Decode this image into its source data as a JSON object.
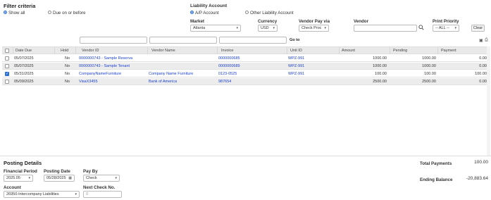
{
  "filter": {
    "title": "Filter criteria",
    "show_all": "Show all",
    "due_on_or_before": "Due on or before"
  },
  "liability": {
    "title": "Liability Account",
    "ap_account": "A/P Account",
    "other": "Other Liability Account"
  },
  "market": {
    "label": "Market",
    "value": "Atlanta"
  },
  "currency": {
    "label": "Currency",
    "value": "USD"
  },
  "vendor_pay_via": {
    "label": "Vendor Pay via",
    "value": "Check Proc"
  },
  "vendor": {
    "label": "Vendor",
    "value": ""
  },
  "print_priority": {
    "label": "Print Priority",
    "value": "-- ALL --"
  },
  "clear_label": "Clear",
  "goto_label": "Go to",
  "grid": {
    "headers": [
      "Date Due",
      "Hold",
      "Vendor ID",
      "Vendor Name",
      "Invoice",
      "Unit ID",
      "Amount",
      "Pending",
      "Payment"
    ],
    "rows": [
      {
        "checked": false,
        "date_due": "05/07/2025",
        "hold": "No",
        "vendor_id": "0000000743 - Sample Reserva",
        "vendor_name": "",
        "invoice": "0000000685",
        "unit_id": "WPZ-991",
        "amount": "1000.00",
        "pending": "1000.00",
        "payment": "0.00"
      },
      {
        "checked": false,
        "date_due": "05/07/2025",
        "hold": "No",
        "vendor_id": "0000000743 - Sample Tenant",
        "vendor_name": "",
        "invoice": "0000000689",
        "unit_id": "WPZ-991",
        "amount": "1000.00",
        "pending": "1000.00",
        "payment": "0.00"
      },
      {
        "checked": true,
        "date_due": "05/31/2025",
        "hold": "No",
        "vendor_id": "CompanyNameFurniture",
        "vendor_name": "Company Name Furniture",
        "invoice": "0123-0525",
        "unit_id": "WPZ-991",
        "amount": "100.00",
        "pending": "100.00",
        "payment": "100.00"
      },
      {
        "checked": false,
        "date_due": "05/09/2025",
        "hold": "No",
        "vendor_id": "VisaX3455",
        "vendor_name": "Bank of America",
        "invoice": "987654",
        "unit_id": "",
        "amount": "2500.00",
        "pending": "2500.00",
        "payment": "0.00"
      }
    ]
  },
  "posting": {
    "title": "Posting Details",
    "financial_period_label": "Financial Period",
    "financial_period_value": "2025.05",
    "posting_date_label": "Posting Date",
    "posting_date_value": "05/28/2025",
    "pay_by_label": "Pay By",
    "pay_by_value": "Check",
    "account_label": "Account",
    "account_value": "26950-Intercompany Liabilities",
    "next_check_label": "Next Check No.",
    "next_check_value": "0"
  },
  "totals": {
    "total_payments_label": "Total Payments",
    "total_payments_value": "100.00",
    "ending_balance_label": "Ending Balance",
    "ending_balance_value": "-20,883.64"
  },
  "colors": {
    "accent": "#2a6fd6",
    "link": "#1a3fd1",
    "header_bg": "#e9e9e9"
  }
}
